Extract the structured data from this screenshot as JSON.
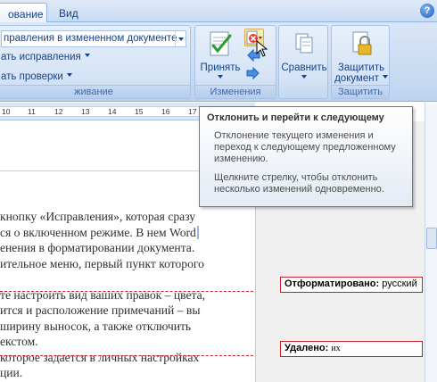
{
  "tabs": [
    {
      "label": "ование",
      "active": true
    },
    {
      "label": "Вид",
      "active": false
    }
  ],
  "help_icon": "help-icon",
  "tracking_group": {
    "display_combo_value": "правления в измененном документе",
    "show_markup_label": "ать исправления",
    "reviewing_pane_label": "ать проверки",
    "group_label": "живание"
  },
  "changes_group": {
    "accept_label": "Принять",
    "group_label": "Изменения"
  },
  "compare_group": {
    "compare_label": "Сравнить"
  },
  "protect_group": {
    "protect_label_line1": "Защитить",
    "protect_label_line2": "документ",
    "group_label": "Защитить"
  },
  "ruler": {
    "numbers": [
      "10",
      "11",
      "12",
      "13",
      "14",
      "15",
      "16",
      "17"
    ]
  },
  "document": {
    "lines": [
      "кнопку «Исправления», которая сразу",
      "ся о включенном режиме. В нем Word",
      "енения в форматировании документа.",
      "ительное меню, первый пункт которого",
      "",
      "те настроить вид ваших правок – цвета,",
      "ится и расположение примечаний – вы",
      "ширину выносок, а также отключить",
      "екстом.",
      "которое задается в личных настройках",
      "ции."
    ]
  },
  "balloons": [
    {
      "type_label": "Отформатировано:",
      "value": "русский"
    },
    {
      "type_label": "Удалено:",
      "value": "их"
    }
  ],
  "tooltip": {
    "title": "Отклонить и перейти к следующему",
    "para1": [
      "Отклонение текущего изменения и",
      "переход к следующему предложенному",
      "изменению."
    ],
    "para2": [
      "Щелкните стрелку, чтобы отклонить",
      "несколько изменений одновременно."
    ]
  },
  "colors": {
    "ribbon_text": "#15428b",
    "markup_red": "#c8202a",
    "ribbon_bg": "#c7daf2"
  }
}
